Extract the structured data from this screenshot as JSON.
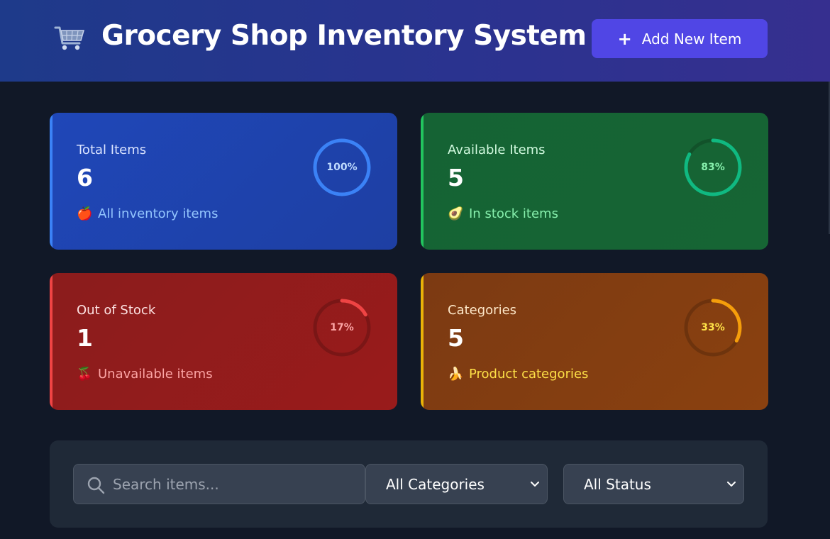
{
  "header": {
    "title": "Grocery Shop Inventory System",
    "logo_icon": "shopping-cart-icon",
    "add_button_label": "Add New Item",
    "add_button_icon": "plus-icon",
    "colors": {
      "gradient_start": "#1e3a8a",
      "gradient_end": "#362f8f",
      "button": "#5046e5"
    }
  },
  "stats": [
    {
      "title": "Total Items",
      "value": "6",
      "description": "All inventory items",
      "emoji": "🍎",
      "percent": 100,
      "percent_label": "100%",
      "color": "#3b82f6"
    },
    {
      "title": "Available Items",
      "value": "5",
      "description": "In stock items",
      "emoji": "🥑",
      "percent": 83,
      "percent_label": "83%",
      "color": "#10b981"
    },
    {
      "title": "Out of Stock",
      "value": "1",
      "description": "Unavailable items",
      "emoji": "🍒",
      "percent": 17,
      "percent_label": "17%",
      "color": "#ef4444"
    },
    {
      "title": "Categories",
      "value": "5",
      "description": "Product categories",
      "emoji": "🍌",
      "percent": 33,
      "percent_label": "33%",
      "color": "#f59e0b"
    }
  ],
  "filters": {
    "search_placeholder": "Search items...",
    "category_selected": "All Categories",
    "status_selected": "All Status"
  }
}
